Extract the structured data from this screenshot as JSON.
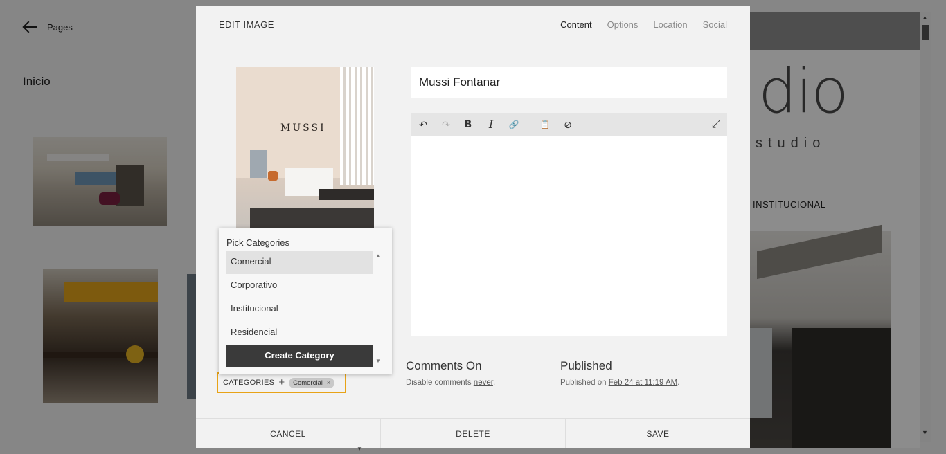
{
  "background": {
    "back_label": "Pages",
    "page_title": "Inicio",
    "preview_logo": "dio",
    "preview_logo_sub": "studio",
    "preview_category": "INSTITUCIONAL"
  },
  "modal": {
    "title": "EDIT IMAGE",
    "tabs": [
      {
        "label": "Content",
        "active": true
      },
      {
        "label": "Options",
        "active": false
      },
      {
        "label": "Location",
        "active": false
      },
      {
        "label": "Social",
        "active": false
      }
    ],
    "image_brand": "MUSSI",
    "title_value": "Mussi Fontanar",
    "toolbar": {
      "undo_icon": "↶",
      "redo_icon": "↷",
      "bold_icon": "B",
      "italic_icon": "I",
      "link_icon": "🔗",
      "clipboard_icon": "📋",
      "clear_icon": "⊘",
      "expand_icon": "⤢"
    },
    "comments": {
      "title": "Comments On",
      "sub_prefix": "Disable comments ",
      "sub_link": "never",
      "sub_suffix": "."
    },
    "published": {
      "title": "Published",
      "sub_prefix": "Published on ",
      "sub_link": "Feb 24 at 11:19 AM",
      "sub_suffix": "."
    },
    "footer": {
      "cancel": "CANCEL",
      "delete": "DELETE",
      "save": "SAVE"
    }
  },
  "categories": {
    "label": "CATEGORIES",
    "plus": "+",
    "selected_chip": "Comercial",
    "chip_remove": "×",
    "dropdown": {
      "title": "Pick Categories",
      "items": [
        {
          "label": "Comercial",
          "selected": true
        },
        {
          "label": "Corporativo",
          "selected": false
        },
        {
          "label": "Institucional",
          "selected": false
        },
        {
          "label": "Residencial",
          "selected": false
        }
      ],
      "create_label": "Create Category"
    },
    "highlight_color": "#e8a317"
  }
}
